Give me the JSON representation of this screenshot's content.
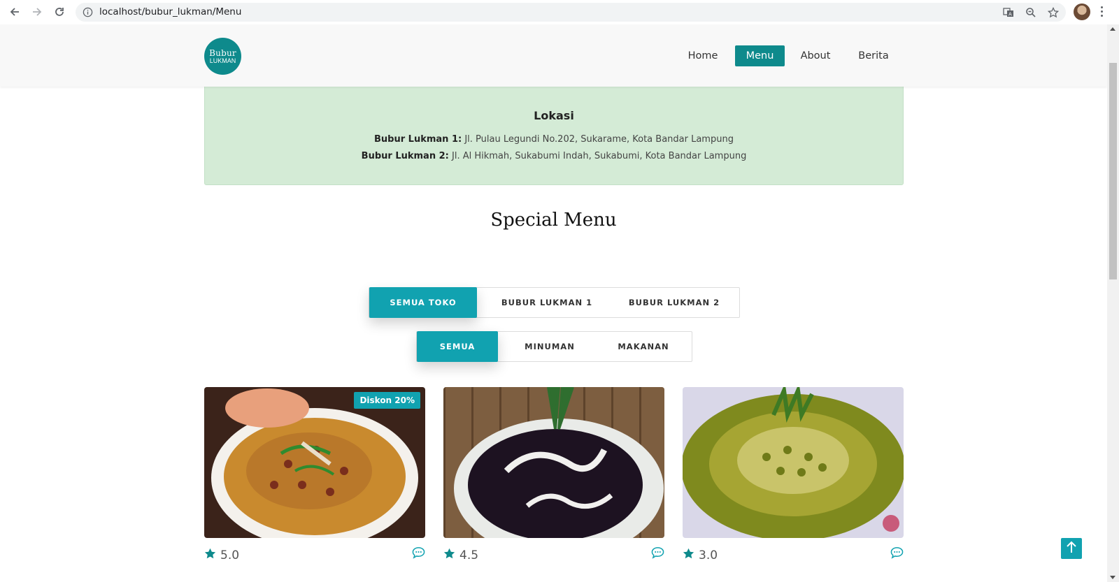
{
  "browser": {
    "url": "localhost/bubur_lukman/Menu"
  },
  "header": {
    "logo_line1": "Bubur",
    "logo_line2": "LUKMAN",
    "nav": [
      {
        "label": "Home"
      },
      {
        "label": "Menu",
        "active": true
      },
      {
        "label": "About"
      },
      {
        "label": "Berita"
      }
    ]
  },
  "location": {
    "title": "Lokasi",
    "stores": [
      {
        "name": "Bubur Lukman 1:",
        "address": " Jl. Pulau Legundi No.202, Sukarame, Kota Bandar Lampung"
      },
      {
        "name": "Bubur Lukman 2:",
        "address": " Jl. Al Hikmah, Sukabumi Indah, Sukabumi, Kota Bandar Lampung"
      }
    ]
  },
  "section_title": "Special Menu",
  "filters": {
    "store": [
      "SEMUA TOKO",
      "BUBUR LUKMAN 1",
      "BUBUR LUKMAN 2"
    ],
    "store_active": "SEMUA TOKO",
    "category": [
      "SEMUA",
      "MINUMAN",
      "MAKANAN"
    ],
    "category_active": "SEMUA"
  },
  "cards": [
    {
      "badge": "Diskon 20%",
      "rating": "5.0"
    },
    {
      "rating": "4.5"
    },
    {
      "rating": "3.0"
    }
  ],
  "colors": {
    "brand": "#0e8a8c",
    "accent": "#11a2b0",
    "location_bg": "#d4ebd6"
  }
}
